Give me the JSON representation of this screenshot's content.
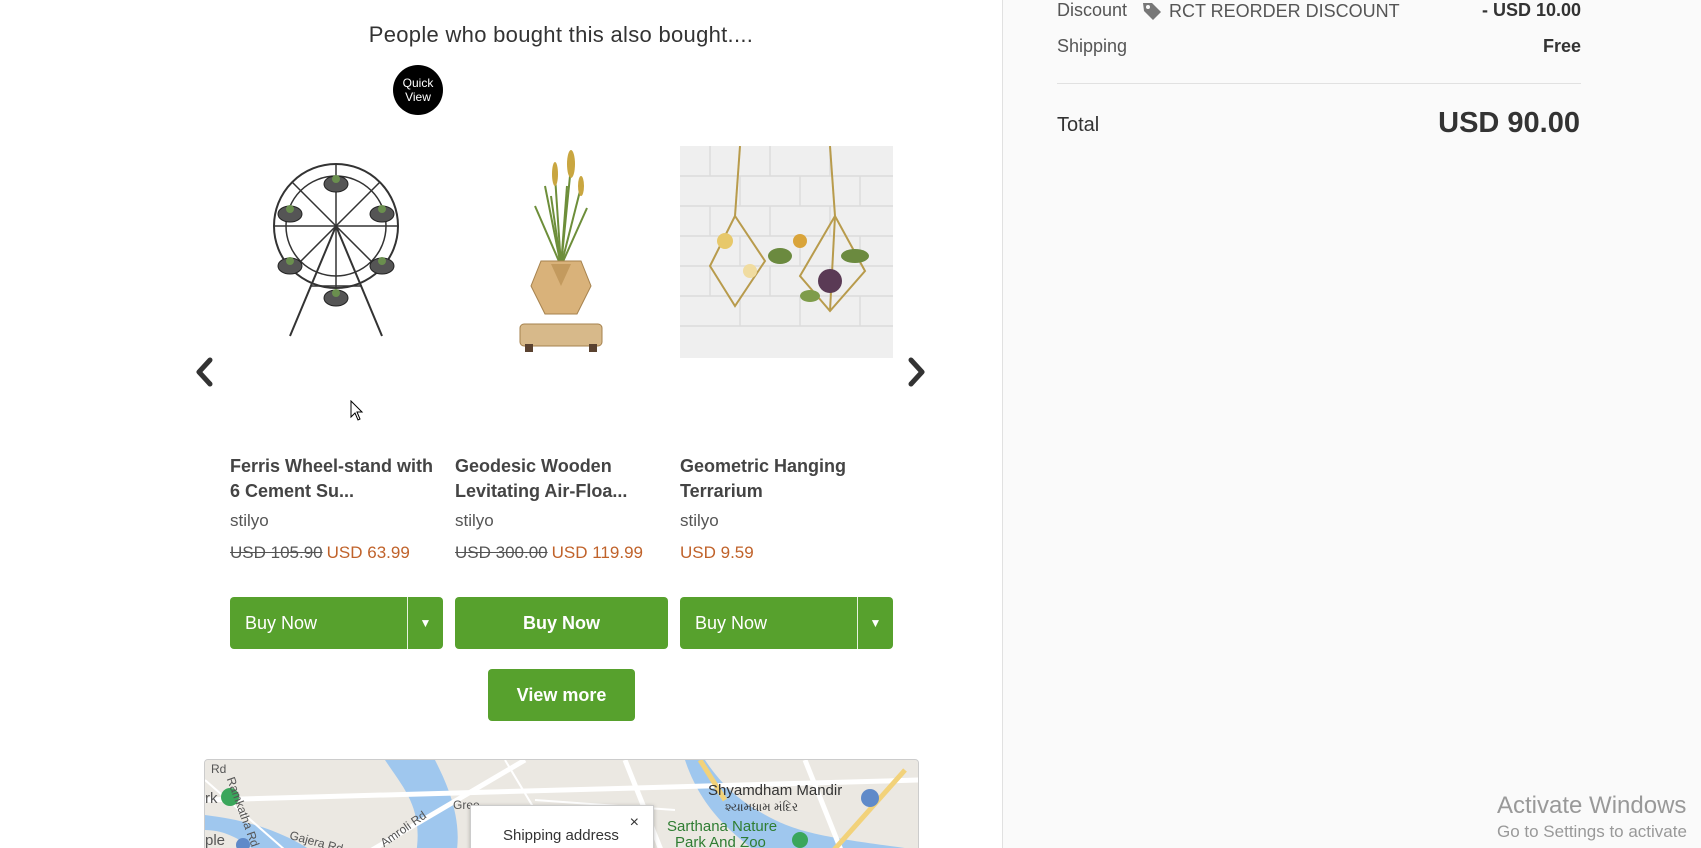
{
  "recommendations": {
    "title": "People who bought this also bought....",
    "quick_view": "Quick\nView",
    "products": [
      {
        "name": "Ferris Wheel-stand with 6 Cement Su...",
        "vendor": "stilyo",
        "old_price": "USD 105.90",
        "price": "USD 63.99",
        "buy_label": "Buy Now",
        "has_dropdown": true
      },
      {
        "name": "Geodesic Wooden Levitating Air-Floa...",
        "vendor": "stilyo",
        "old_price": "USD 300.00",
        "price": "USD 119.99",
        "buy_label": "Buy Now",
        "has_dropdown": false
      },
      {
        "name": "Geometric Hanging Terrarium",
        "vendor": "stilyo",
        "old_price": "",
        "price": "USD 9.59",
        "buy_label": "Buy Now",
        "has_dropdown": true
      }
    ],
    "view_more": "View more"
  },
  "map": {
    "labels": [
      "Rd",
      "Ramkatha Rd",
      "Amroli Rd",
      "Gajera Rd",
      "Gree",
      "rk",
      "ple"
    ],
    "places": [
      "Shyamdham Mandir",
      "શ્યામધામ મંદિર",
      "Sarthana Nature",
      "Park And Zoo"
    ],
    "popup_label": "Shipping address",
    "popup_close": "×"
  },
  "summary": {
    "discount_label": "Discount",
    "discount_code": "RCT REORDER DISCOUNT",
    "discount_value": "- USD 10.00",
    "shipping_label": "Shipping",
    "shipping_value": "Free",
    "total_label": "Total",
    "total_value": "USD 90.00"
  },
  "watermark": {
    "line1": "Activate Windows",
    "line2": "Go to Settings to activate"
  },
  "colors": {
    "button_green": "#57a12d",
    "sale_price": "#c0622a"
  },
  "icons": [
    "chevron-left-icon",
    "chevron-right-icon",
    "caret-down-icon",
    "tag-icon",
    "close-icon",
    "cursor-icon"
  ]
}
